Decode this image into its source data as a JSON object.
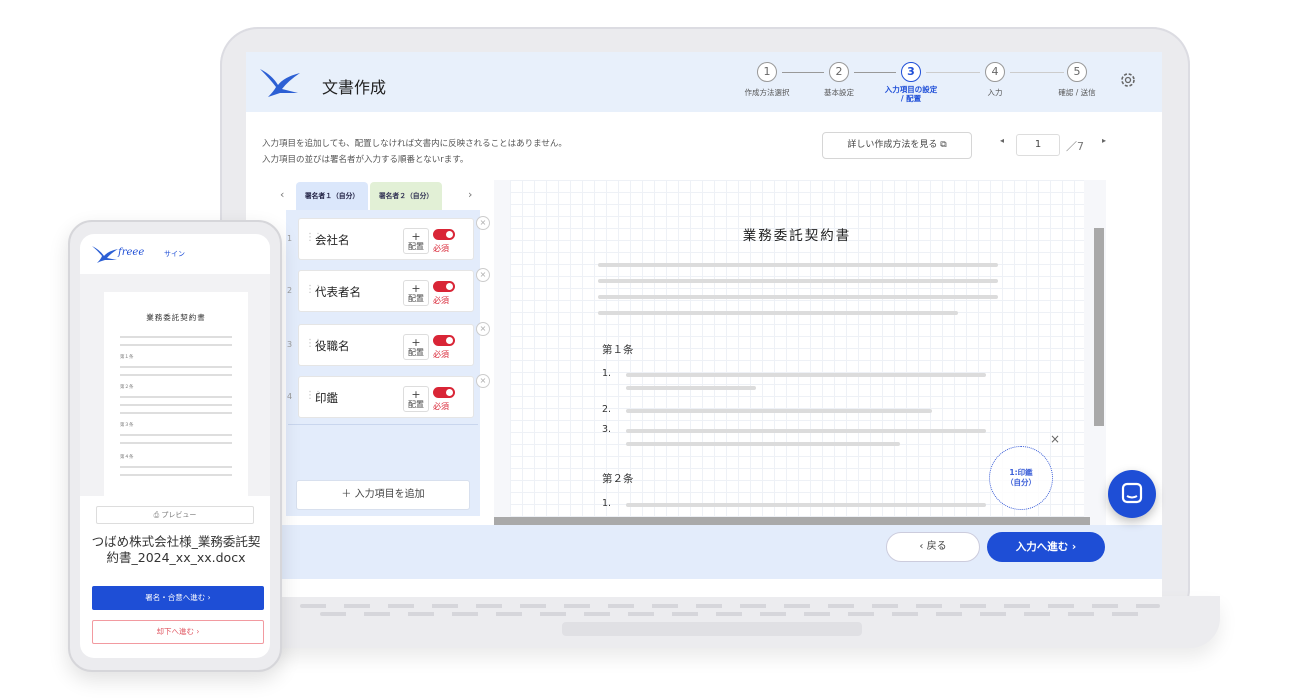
{
  "app": {
    "title": "文書作成"
  },
  "steps": [
    {
      "number": "1",
      "label": "作成方法選択"
    },
    {
      "number": "2",
      "label": "基本設定"
    },
    {
      "number": "3",
      "label_line1": "入力項目の設定",
      "label_line2": "/ 配置"
    },
    {
      "number": "4",
      "label": "入力"
    },
    {
      "number": "5",
      "label": "確認 / 送信"
    }
  ],
  "info": {
    "line1": "入力項目を追加しても、配置しなければ文書内に反映されることはありません。",
    "line2": "入力項目の並びは署名者が入力する順番とないrます。"
  },
  "howto_button": "詳しい作成方法を見る ⧉",
  "pager": {
    "prev": "◂",
    "current": "1",
    "total": "／7",
    "next": "▸"
  },
  "signer_tabs": {
    "prev": "‹",
    "next": "›",
    "tab1": "署名者１（自分）",
    "tab2": "署名者２（自分）"
  },
  "fields": [
    {
      "num": "1",
      "name": "会社名",
      "place_plus": "+",
      "place_label": "配置",
      "required": "必須",
      "remove": "×"
    },
    {
      "num": "2",
      "name": "代表者名",
      "place_plus": "+",
      "place_label": "配置",
      "required": "必須",
      "remove": "×"
    },
    {
      "num": "3",
      "name": "役職名",
      "place_plus": "+",
      "place_label": "配置",
      "required": "必須",
      "remove": "×"
    },
    {
      "num": "4",
      "name": "印鑑",
      "place_plus": "+",
      "place_label": "配置",
      "required": "必須",
      "remove": "×"
    }
  ],
  "add_field_button": "＋  入力項目を追加",
  "document": {
    "title": "業務委託契約書",
    "article1": "第１条",
    "article2": "第２条",
    "items": [
      "1.",
      "2.",
      "3.",
      "1."
    ],
    "stamp_line1": "1:印鑑",
    "stamp_line2": "（自分）",
    "stamp_close": "×"
  },
  "footer": {
    "back": "‹  戻る",
    "next": "入力へ進む  ›"
  },
  "phone": {
    "brand": "freee",
    "brand_sub": "サイン",
    "doc_title": "業務委託契約書",
    "articles": [
      "第１条",
      "第２条",
      "第３条",
      "第４条"
    ],
    "preview_button": "⎙ プレビュー",
    "filename": "つばめ株式会社様_業務委託契約書_2024_xx_xx.docx",
    "sign_button": "署名・合意へ進む  ›",
    "decline_button": "却下へ進む  ›"
  },
  "colors": {
    "accent": "#1e4ed6",
    "required": "#d92536",
    "panel": "#e3ecfb"
  }
}
